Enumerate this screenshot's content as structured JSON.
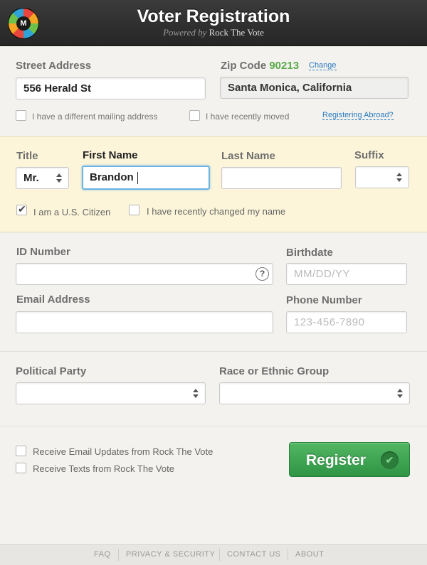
{
  "header": {
    "title": "Voter Registration",
    "powered_by": "Powered by",
    "brand": "Rock The Vote",
    "logo_letter": "M"
  },
  "address": {
    "street_label": "Street Address",
    "street_value": "556 Herald St",
    "zip_label": "Zip Code",
    "zip_value": "90213",
    "zip_change": "Change",
    "city_value": "Santa Monica, California",
    "different_mailing": "I have a different mailing address",
    "recently_moved": "I have recently moved",
    "abroad_link": "Registering Abroad?"
  },
  "name": {
    "title_label": "Title",
    "title_value": "Mr.",
    "first_label": "First Name",
    "first_value": "Brandon",
    "last_label": "Last Name",
    "last_value": "",
    "suffix_label": "Suffix",
    "suffix_value": "",
    "citizen_label": "I am a U.S. Citizen",
    "citizen_checked": true,
    "changed_name_label": "I have recently changed my name",
    "changed_name_checked": false
  },
  "identity": {
    "id_label": "ID Number",
    "id_value": "",
    "help": "?",
    "birthdate_label": "Birthdate",
    "birthdate_placeholder": "MM/DD/YY",
    "email_label": "Email Address",
    "email_value": "",
    "phone_label": "Phone Number",
    "phone_placeholder": "123-456-7890"
  },
  "affiliation": {
    "party_label": "Political Party",
    "party_value": "",
    "race_label": "Race or Ethnic Group",
    "race_value": ""
  },
  "optin": {
    "email_updates": "Receive Email Updates from Rock The Vote",
    "texts": "Receive Texts from Rock The Vote"
  },
  "register_button": {
    "label": "Register",
    "icon": "check-circle-icon"
  },
  "footer": {
    "items": [
      "FAQ",
      "PRIVACY & SECURITY",
      "CONTACT US",
      "ABOUT"
    ]
  },
  "colors": {
    "accent_green": "#3aa34f",
    "link_blue": "#2a7bbf",
    "highlight_yellow": "#fcf5d9"
  }
}
